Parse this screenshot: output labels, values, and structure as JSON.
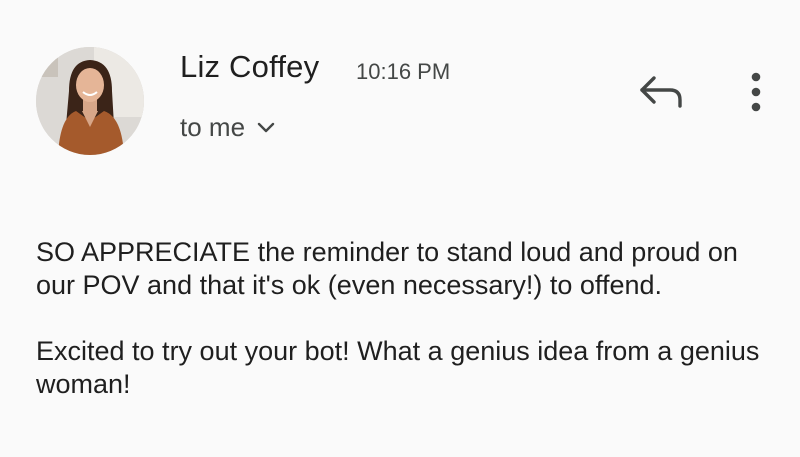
{
  "email": {
    "sender_name": "Liz Coffey",
    "time": "10:16 PM",
    "recipient_label": "to me",
    "avatar": {
      "icon": "sender-avatar-photo",
      "background": "#d9d6d2"
    },
    "actions": {
      "reply_icon": "reply-arrow-icon",
      "more_icon": "vertical-dots-icon",
      "expand_icon": "chevron-down-icon"
    },
    "body": {
      "paragraphs": [
        "SO APPRECIATE the reminder to stand loud and proud on our POV and that it's ok (even necessary!) to offend.",
        "Excited to try out your bot! What a genius idea from a genius woman!"
      ]
    }
  },
  "colors": {
    "background": "#fafafa",
    "primary_text": "#1f1f1f",
    "secondary_text": "#444746",
    "icon": "#444746"
  }
}
